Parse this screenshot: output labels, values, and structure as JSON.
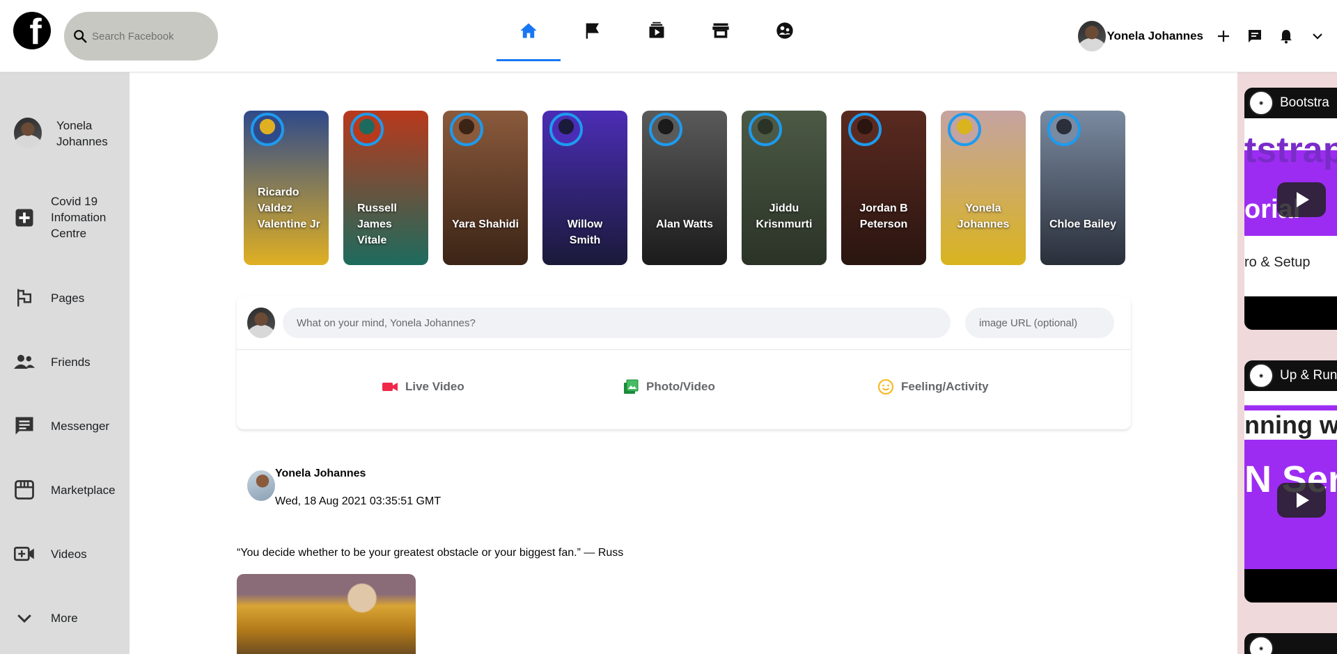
{
  "header": {
    "logo_letter": "f",
    "search_placeholder": "Search Facebook",
    "nav_tabs": [
      {
        "icon": "home-icon",
        "active": true
      },
      {
        "icon": "flag-icon",
        "active": false
      },
      {
        "icon": "watch-icon",
        "active": false
      },
      {
        "icon": "marketplace-icon",
        "active": false
      },
      {
        "icon": "groups-icon",
        "active": false
      }
    ],
    "profile_name": "Yonela Johannes",
    "right_icons": [
      "plus-icon",
      "messenger-icon",
      "bell-icon",
      "chevron-down-icon"
    ]
  },
  "sidebar": {
    "user_name": "Yonela Johannes",
    "items": [
      {
        "label": "Covid 19 Infomation Centre",
        "icon": "covid-plus-icon"
      },
      {
        "label": "Pages",
        "icon": "flag-icon"
      },
      {
        "label": "Friends",
        "icon": "friends-icon"
      },
      {
        "label": "Messenger",
        "icon": "chat-icon"
      },
      {
        "label": "Marketplace",
        "icon": "store-icon"
      },
      {
        "label": "Videos",
        "icon": "video-icon"
      },
      {
        "label": "More",
        "icon": "chevron-down-icon"
      }
    ]
  },
  "stories": [
    {
      "name": "Ricardo Valdez Valentine Jr",
      "bg": "#2f4a8a",
      "accent": "#e0b023"
    },
    {
      "name": "Russell James Vitale",
      "bg": "#b8391c",
      "accent": "#1d6b5e"
    },
    {
      "name": "Yara Shahidi",
      "bg": "#8a5a3c",
      "accent": "#3b2416"
    },
    {
      "name": "Willow Smith",
      "bg": "#4b2db5",
      "accent": "#1a1a3a"
    },
    {
      "name": "Alan Watts",
      "bg": "#5a5a5a",
      "accent": "#1b1b1b"
    },
    {
      "name": "Jiddu Krisnmurti",
      "bg": "#4c5a45",
      "accent": "#2b3327"
    },
    {
      "name": "Jordan B Peterson",
      "bg": "#5a2a20",
      "accent": "#2a1510"
    },
    {
      "name": "Yonela Johannes",
      "bg": "#c5a3a0",
      "accent": "#d9b41f"
    },
    {
      "name": "Chloe Bailey",
      "bg": "#7a8aa0",
      "accent": "#2a2f3a"
    }
  ],
  "composer": {
    "post_placeholder": "What on your mind, Yonela Johannes?",
    "url_placeholder": "image URL (optional)",
    "actions": [
      {
        "label": "Live Video",
        "icon": "live-video-icon",
        "color": "#f02849"
      },
      {
        "label": "Photo/Video",
        "icon": "photo-icon",
        "color": "#45bd62"
      },
      {
        "label": "Feeling/Activity",
        "icon": "smile-icon",
        "color": "#f7b928"
      }
    ]
  },
  "post": {
    "author": "Yonela Johannes",
    "timestamp": "Wed, 18 Aug 2021 03:35:51 GMT",
    "text": "“You decide whether to be your greatest obstacle or your biggest fan.” — Russ"
  },
  "right_rail": {
    "videos": [
      {
        "title": "Bootstra",
        "line1": "tstrap",
        "line2": "orial",
        "line3": "ro & Setup"
      },
      {
        "title": "Up & Run",
        "line1": "nning wit",
        "line2": "N Serv",
        "line3": ""
      }
    ]
  }
}
